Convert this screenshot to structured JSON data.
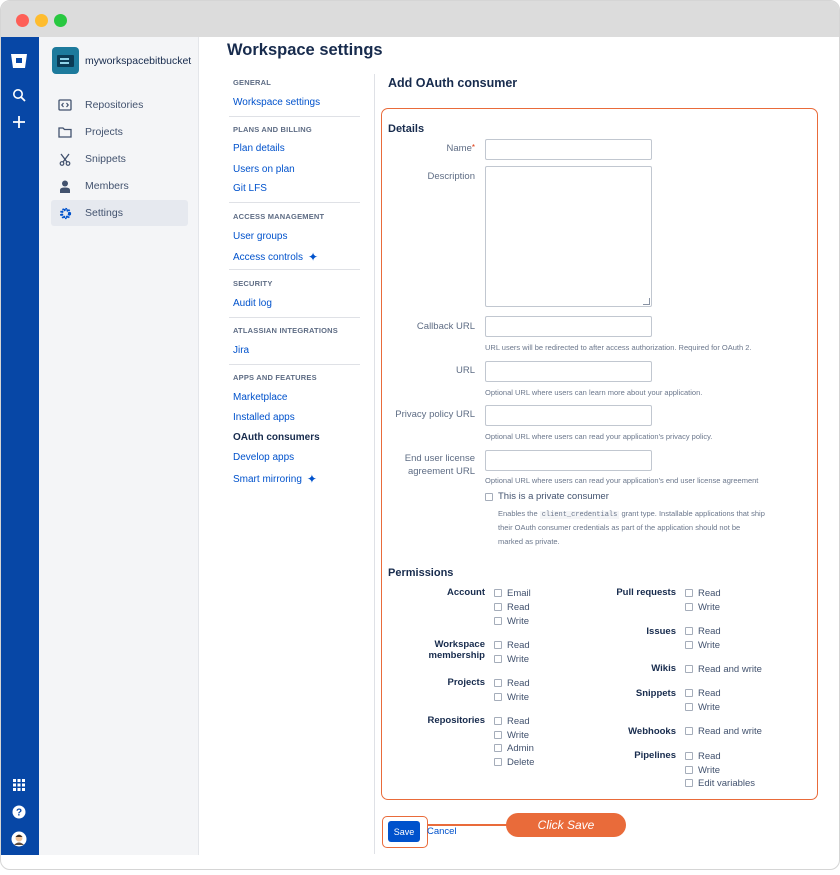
{
  "sidebar": {
    "workspace_name": "myworkspacebitbucket",
    "items": [
      {
        "label": "Repositories",
        "icon": "repository-icon"
      },
      {
        "label": "Projects",
        "icon": "folder-icon"
      },
      {
        "label": "Snippets",
        "icon": "scissors-icon"
      },
      {
        "label": "Members",
        "icon": "person-icon"
      },
      {
        "label": "Settings",
        "icon": "gear-icon",
        "active": true
      }
    ]
  },
  "page": {
    "title": "Workspace settings"
  },
  "settings_nav": {
    "general": {
      "title": "GENERAL",
      "links": [
        "Workspace settings"
      ]
    },
    "plans": {
      "title": "PLANS AND BILLING",
      "links": [
        "Plan details",
        "Users on plan",
        "Git LFS"
      ]
    },
    "access": {
      "title": "ACCESS MANAGEMENT",
      "links": [
        "User groups",
        "Access controls"
      ]
    },
    "security": {
      "title": "SECURITY",
      "links": [
        "Audit log"
      ]
    },
    "integrations": {
      "title": "ATLASSIAN INTEGRATIONS",
      "links": [
        "Jira"
      ]
    },
    "apps": {
      "title": "APPS AND FEATURES",
      "links": [
        "Marketplace",
        "Installed apps",
        "OAuth consumers",
        "Develop apps",
        "Smart mirroring"
      ]
    }
  },
  "form": {
    "title": "Add OAuth consumer",
    "details_heading": "Details",
    "name_label": "Name",
    "required_mark": "*",
    "description_label": "Description",
    "callback_label": "Callback URL",
    "callback_help": "URL users will be redirected to after access authorization. Required for OAuth 2.",
    "url_label": "URL",
    "url_help": "Optional URL where users can learn more about your application.",
    "privacy_label": "Privacy policy URL",
    "privacy_help": "Optional URL where users can read your application's privacy policy.",
    "eula_label_1": "End user license",
    "eula_label_2": "agreement URL",
    "eula_help": "Optional URL where users can read your application's end user license agreement",
    "private_label": "This is a private consumer",
    "private_help_1": "Enables the",
    "private_help_code": "client_credentials",
    "private_help_2": "grant type. Installable applications that ship",
    "private_help_3": "their OAuth consumer credentials as part of the application should not be",
    "private_help_4": "marked as private."
  },
  "permissions": {
    "heading": "Permissions",
    "account": "Account",
    "workspace_1": "Workspace",
    "workspace_2": "membership",
    "projects": "Projects",
    "repositories": "Repositories",
    "pull_requests": "Pull requests",
    "issues": "Issues",
    "wikis": "Wikis",
    "snippets": "Snippets",
    "webhooks": "Webhooks",
    "pipelines": "Pipelines",
    "opt_email": "Email",
    "opt_read": "Read",
    "opt_write": "Write",
    "opt_admin": "Admin",
    "opt_delete": "Delete",
    "opt_read_write": "Read and write",
    "opt_edit_vars": "Edit variables"
  },
  "actions": {
    "save": "Save",
    "cancel": "Cancel",
    "callout": "Click Save"
  },
  "colors": {
    "brand": "#0747a6",
    "link": "#0052cc",
    "highlight": "#e96b3a"
  }
}
